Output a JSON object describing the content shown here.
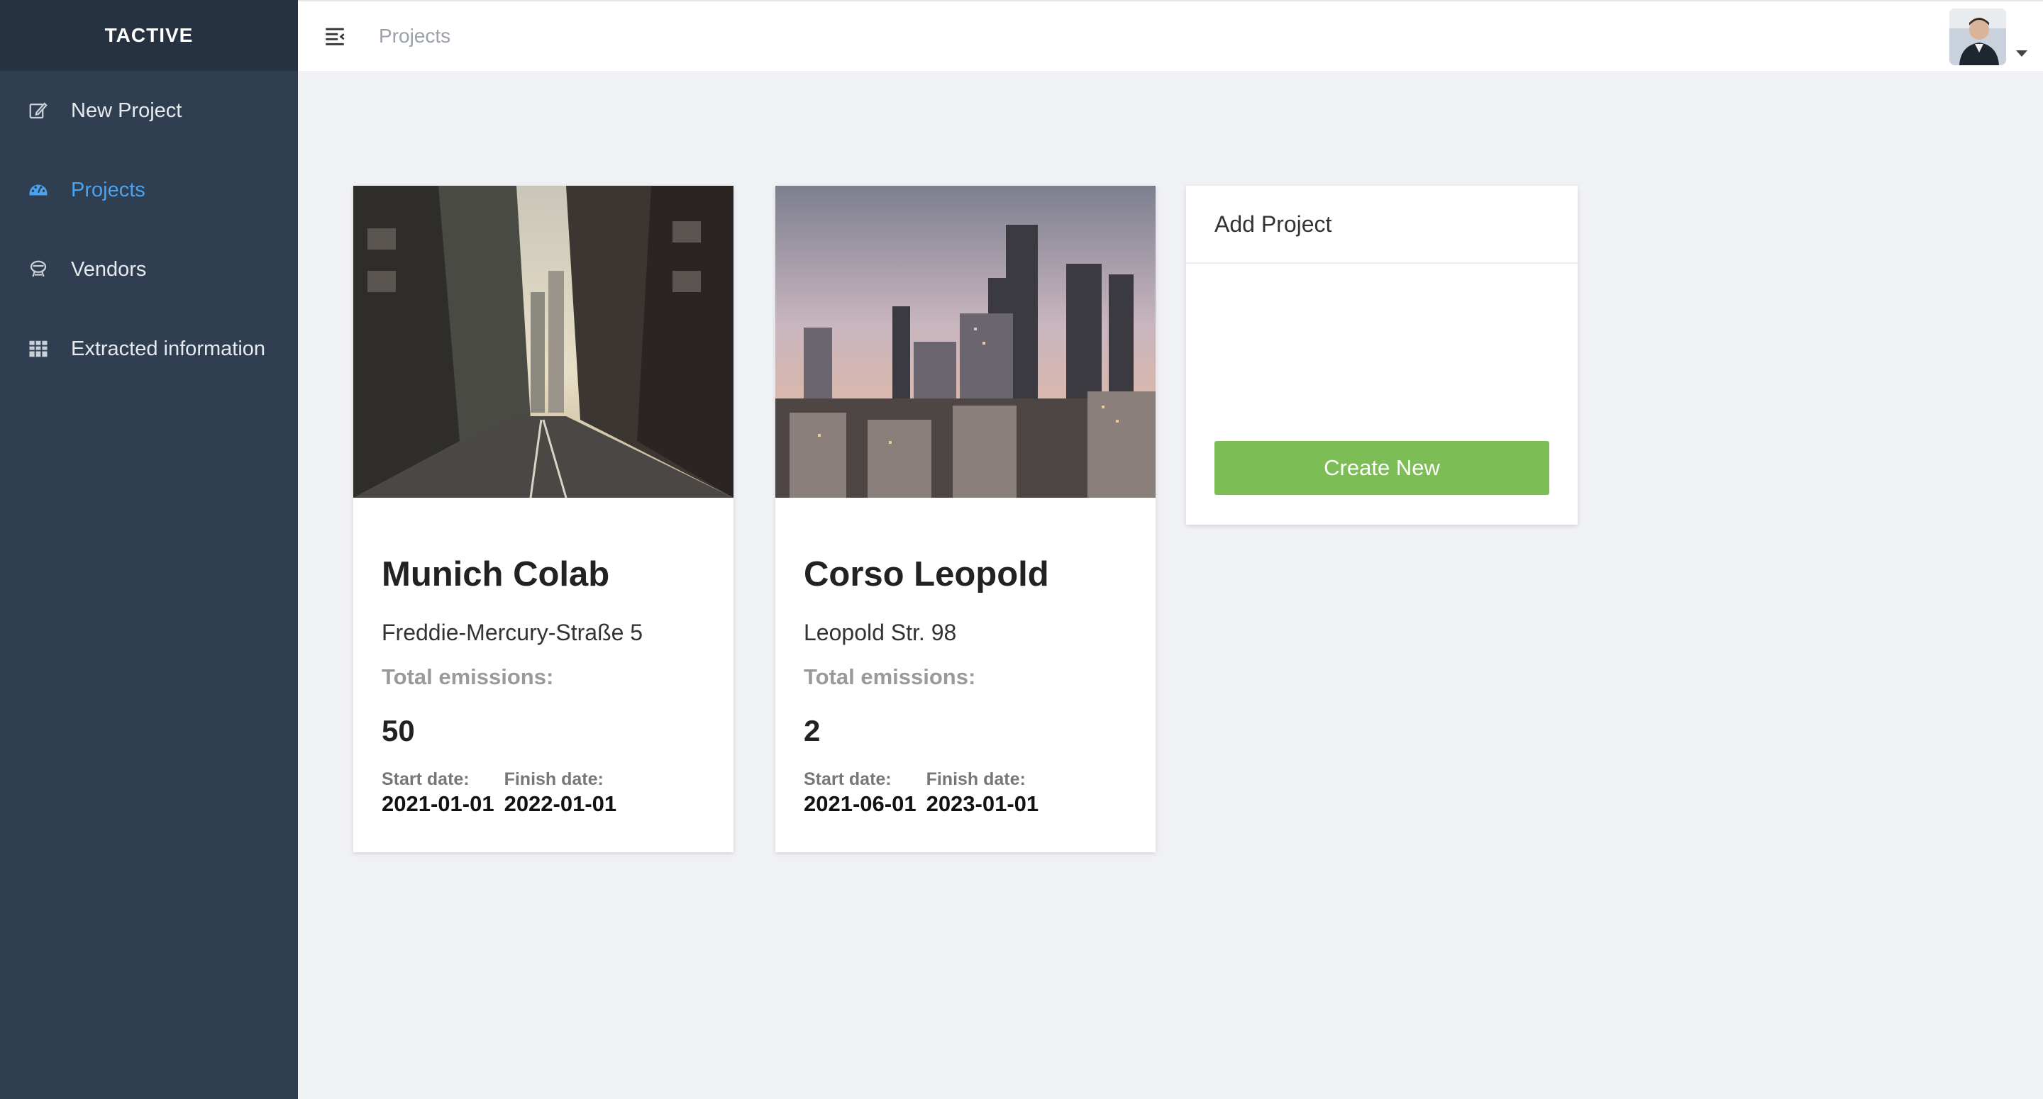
{
  "app": {
    "brand": "TACTIVE"
  },
  "sidebar": {
    "items": [
      {
        "label": "New Project",
        "icon": "edit-icon",
        "active": false
      },
      {
        "label": "Projects",
        "icon": "dashboard-icon",
        "active": true
      },
      {
        "label": "Vendors",
        "icon": "vendor-icon",
        "active": false
      },
      {
        "label": "Extracted information",
        "icon": "grid-icon",
        "active": false
      }
    ]
  },
  "header": {
    "breadcrumb": "Projects"
  },
  "projects": [
    {
      "title": "Munich Colab",
      "address": "Freddie-Mercury-Straße 5",
      "emissions_label": "Total emissions:",
      "emissions_value": "50",
      "start_label": "Start date:",
      "start_date": "2021-01-01",
      "finish_label": "Finish date:",
      "finish_date": "2022-01-01"
    },
    {
      "title": "Corso Leopold",
      "address": "Leopold Str. 98",
      "emissions_label": "Total emissions:",
      "emissions_value": "2",
      "start_label": "Start date:",
      "start_date": "2021-06-01",
      "finish_label": "Finish date:",
      "finish_date": "2023-01-01"
    }
  ],
  "add_project": {
    "title": "Add Project",
    "button_label": "Create New"
  },
  "colors": {
    "sidebar": "#2f3f51",
    "brand_bg": "#263241",
    "accent": "#4aa3f0",
    "button": "#7cbd55"
  }
}
